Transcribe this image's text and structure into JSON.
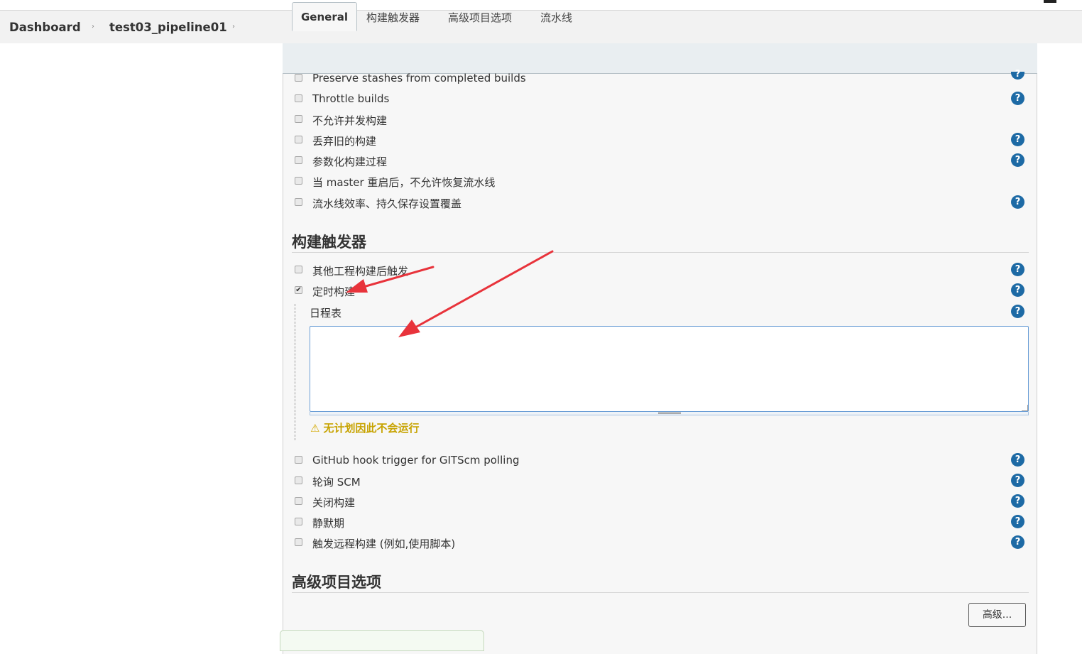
{
  "breadcrumb": {
    "items": [
      "Dashboard",
      "test03_pipeline01"
    ],
    "separator": "›"
  },
  "tabs": [
    {
      "label": "General",
      "active": true
    },
    {
      "label": "构建触发器",
      "active": false
    },
    {
      "label": "高级项目选项",
      "active": false
    },
    {
      "label": "流水线",
      "active": false
    }
  ],
  "general": {
    "options": [
      {
        "label": "Preserve stashes from completed builds",
        "checked": false
      },
      {
        "label": "Throttle builds",
        "checked": false
      },
      {
        "label": "不允许并发构建",
        "checked": false
      },
      {
        "label": "丢弃旧的构建",
        "checked": false
      },
      {
        "label": "参数化构建过程",
        "checked": false
      },
      {
        "label": "当 master 重启后，不允许恢复流水线",
        "checked": false
      },
      {
        "label": "流水线效率、持久保存设置覆盖",
        "checked": false
      }
    ]
  },
  "triggers": {
    "title": "构建触发器",
    "options": [
      {
        "label": "其他工程构建后触发",
        "checked": false
      },
      {
        "label": "定时构建",
        "checked": true
      }
    ],
    "schedule": {
      "label": "日程表",
      "value": "",
      "warning": "无计划因此不会运行"
    },
    "more_options": [
      {
        "label": "GitHub hook trigger for GITScm polling",
        "checked": false
      },
      {
        "label": "轮询 SCM",
        "checked": false
      },
      {
        "label": "关闭构建",
        "checked": false
      },
      {
        "label": "静默期",
        "checked": false
      },
      {
        "label": "触发远程构建 (例如,使用脚本)",
        "checked": false
      }
    ]
  },
  "advanced": {
    "title": "高级项目选项",
    "button_label": "高级..."
  },
  "icons": {
    "help": "help-icon",
    "checkbox": "checkbox-icon",
    "warning": "warning-icon",
    "chevron": "chevron-right-icon"
  },
  "colors": {
    "help_blue": "#1d6aa5",
    "warning_text": "#c7a300",
    "annotation_arrow": "#e8333b",
    "textarea_border": "#6b9ed6"
  },
  "glyphs": {
    "help": "?",
    "check": "✔",
    "warning": "⚠"
  }
}
